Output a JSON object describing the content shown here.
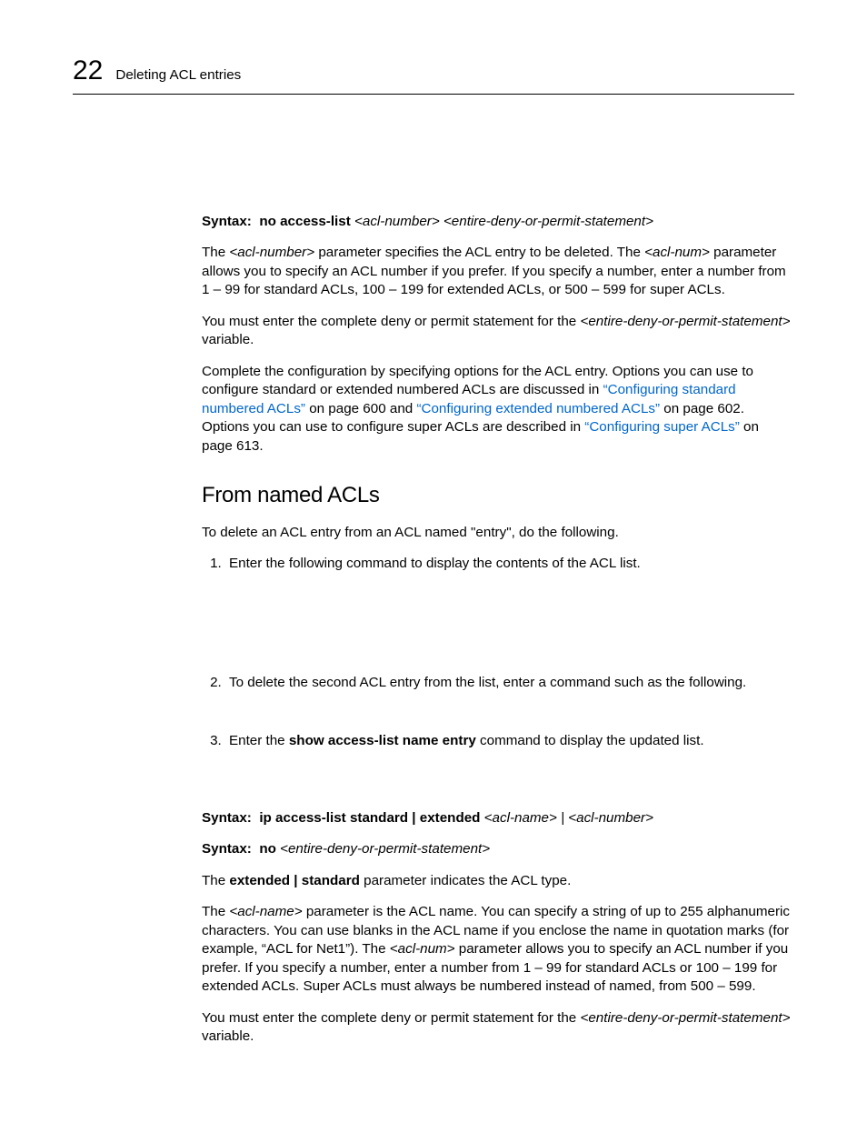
{
  "header": {
    "chapter_number": "22",
    "title": "Deleting ACL entries"
  },
  "syntax1": {
    "label": "Syntax:",
    "cmd": "no access-list ",
    "args": "<acl-number> <entire-deny-or-permit-statement>"
  },
  "para1a": "The ",
  "para1b": "<acl-number>",
  "para1c": " parameter specifies the ACL entry to be deleted. The ",
  "para1d": "<acl-num>",
  "para1e": " parameter allows you to specify an ACL number if you prefer. If you specify a number, enter a number from 1 – 99 for standard ACLs, 100 – 199 for extended ACLs, or 500 – 599 for super ACLs.",
  "para2a": "You must enter the complete deny or permit statement for the ",
  "para2b": "<entire-deny-or-permit-statement>",
  "para2c": " variable.",
  "para3a": "Complete the configuration by specifying options for the ACL entry. Options you can use to configure standard or extended numbered ACLs are discussed in ",
  "link1": "“Configuring standard numbered ACLs”",
  "para3b": " on page 600 and ",
  "link2": "“Configuring extended numbered ACLs”",
  "para3c": " on page 602. Options you can use to configure super ACLs are described in ",
  "link3": "“Configuring super ACLs”",
  "para3d": " on page 613.",
  "section_heading": "From named ACLs",
  "para4": "To delete an ACL entry from an ACL named \"entry\", do the following.",
  "step1": "Enter the following command to display the contents of the ACL list.",
  "step2": "To delete the second ACL entry from the list, enter a command such as the following.",
  "step3a": "Enter the ",
  "step3b": "show access-list name entry",
  "step3c": " command to display the updated list.",
  "syntax2": {
    "label": "Syntax:",
    "cmd": "ip access-list standard | extended ",
    "args": "<acl-name> | <acl-number>"
  },
  "syntax3": {
    "label": "Syntax:",
    "cmd": "no ",
    "args": "<entire-deny-or-permit-statement>"
  },
  "para5a": "The ",
  "para5b": "extended | standard",
  "para5c": " parameter indicates the ACL type.",
  "para6a": "The ",
  "para6b": "<acl-name>",
  "para6c": " parameter is the ACL name. You can specify a string of up to 255 alphanumeric characters. You can use blanks in the ACL name if you enclose the name in quotation marks (for example, “ACL for Net1”). The ",
  "para6d": "<acl-num>",
  "para6e": " parameter allows you to specify an ACL number if you prefer. If you specify a number, enter a number from 1 – 99 for standard ACLs or 100 – 199 for extended ACLs. Super ACLs must always be numbered instead of named, from 500 – 599.",
  "para7a": "You must enter the complete deny or permit statement for the ",
  "para7b": "<entire-deny-or-permit-statement>",
  "para7c": " variable."
}
